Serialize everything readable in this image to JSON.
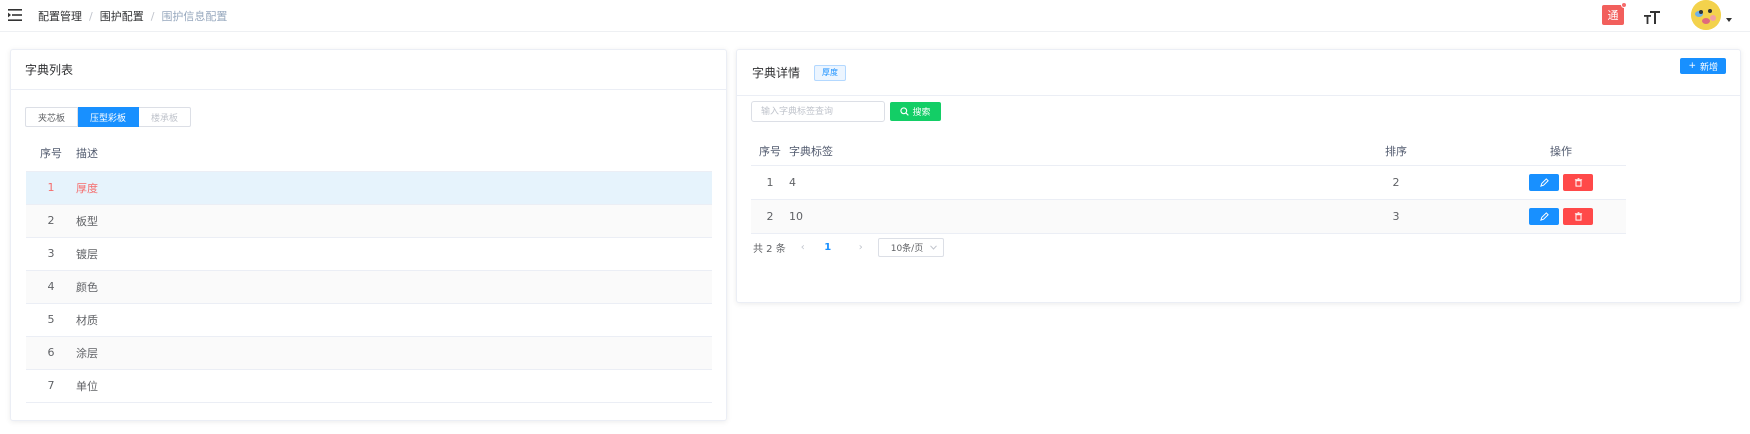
{
  "breadcrumb": [
    "配置管理",
    "围护配置",
    "围护信息配置"
  ],
  "header": {
    "notice_label": "通"
  },
  "left": {
    "title": "字典列表",
    "tabs": [
      {
        "label": "夹芯板",
        "state": "normal"
      },
      {
        "label": "压型彩板",
        "state": "active"
      },
      {
        "label": "楼承板",
        "state": "disabled"
      }
    ],
    "columns": [
      "序号",
      "描述"
    ],
    "rows": [
      {
        "no": "1",
        "desc": "厚度"
      },
      {
        "no": "2",
        "desc": "板型"
      },
      {
        "no": "3",
        "desc": "镀层"
      },
      {
        "no": "4",
        "desc": "颜色"
      },
      {
        "no": "5",
        "desc": "材质"
      },
      {
        "no": "6",
        "desc": "涂层"
      },
      {
        "no": "7",
        "desc": "单位"
      }
    ]
  },
  "right": {
    "title": "字典详情",
    "tag": "厚度",
    "add_label": "新增",
    "search_placeholder": "输入字典标签查询",
    "search_label": "搜索",
    "columns": [
      "序号",
      "字典标签",
      "排序",
      "操作"
    ],
    "rows": [
      {
        "no": "1",
        "label": "4",
        "sort": "2"
      },
      {
        "no": "2",
        "label": "10",
        "sort": "3"
      }
    ],
    "pager": {
      "total": "共 2 条",
      "page": "1",
      "size": "10条/页"
    }
  },
  "colors": {
    "primary": "#1890ff",
    "success": "#13ce66",
    "danger": "#ff4949",
    "selected_row": "#e6f3fc",
    "selected_text": "#f56c6c"
  }
}
